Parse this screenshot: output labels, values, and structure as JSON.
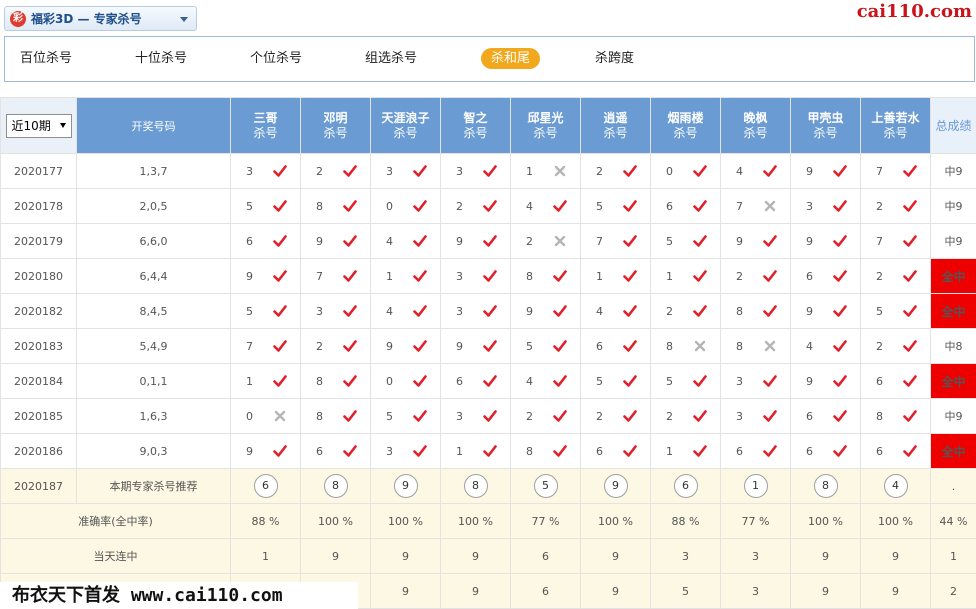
{
  "app": {
    "game_logo": "彩",
    "game_title": "福彩3D — 专家杀号",
    "site_brand": "cai110.com",
    "watermark": "布衣天下首发 www.cai110.com"
  },
  "tabs": [
    {
      "label": "百位杀号"
    },
    {
      "label": "十位杀号"
    },
    {
      "label": "个位杀号"
    },
    {
      "label": "组选杀号"
    },
    {
      "label": "杀和尾"
    },
    {
      "label": "杀跨度"
    }
  ],
  "table": {
    "period_select": "近10期",
    "draw_header": "开奖号码",
    "total_header": "总成绩",
    "expert_subtitle": "杀号",
    "experts": [
      "三哥",
      "邓明",
      "天涯浪子",
      "智之",
      "邱星光",
      "逍遥",
      "烟雨楼",
      "晚枫",
      "甲壳虫",
      "上善若水"
    ],
    "rows": [
      {
        "period": "2020177",
        "draw": "1,3,7",
        "picks": [
          [
            "3",
            "ok"
          ],
          [
            "2",
            "ok"
          ],
          [
            "3",
            "ok"
          ],
          [
            "3",
            "ok"
          ],
          [
            "1",
            "x"
          ],
          [
            "2",
            "ok"
          ],
          [
            "0",
            "ok"
          ],
          [
            "4",
            "ok"
          ],
          [
            "9",
            "ok"
          ],
          [
            "7",
            "ok"
          ]
        ],
        "result": "中9",
        "all": false
      },
      {
        "period": "2020178",
        "draw": "2,0,5",
        "picks": [
          [
            "5",
            "ok"
          ],
          [
            "8",
            "ok"
          ],
          [
            "0",
            "ok"
          ],
          [
            "2",
            "ok"
          ],
          [
            "4",
            "ok"
          ],
          [
            "5",
            "ok"
          ],
          [
            "6",
            "ok"
          ],
          [
            "7",
            "x"
          ],
          [
            "3",
            "ok"
          ],
          [
            "2",
            "ok"
          ]
        ],
        "result": "中9",
        "all": false
      },
      {
        "period": "2020179",
        "draw": "6,6,0",
        "picks": [
          [
            "6",
            "ok"
          ],
          [
            "9",
            "ok"
          ],
          [
            "4",
            "ok"
          ],
          [
            "9",
            "ok"
          ],
          [
            "2",
            "x"
          ],
          [
            "7",
            "ok"
          ],
          [
            "5",
            "ok"
          ],
          [
            "9",
            "ok"
          ],
          [
            "9",
            "ok"
          ],
          [
            "7",
            "ok"
          ]
        ],
        "result": "中9",
        "all": false
      },
      {
        "period": "2020180",
        "draw": "6,4,4",
        "picks": [
          [
            "9",
            "ok"
          ],
          [
            "7",
            "ok"
          ],
          [
            "1",
            "ok"
          ],
          [
            "3",
            "ok"
          ],
          [
            "8",
            "ok"
          ],
          [
            "1",
            "ok"
          ],
          [
            "1",
            "ok"
          ],
          [
            "2",
            "ok"
          ],
          [
            "6",
            "ok"
          ],
          [
            "2",
            "ok"
          ]
        ],
        "result": "全中",
        "all": true
      },
      {
        "period": "2020182",
        "draw": "8,4,5",
        "picks": [
          [
            "5",
            "ok"
          ],
          [
            "3",
            "ok"
          ],
          [
            "4",
            "ok"
          ],
          [
            "3",
            "ok"
          ],
          [
            "9",
            "ok"
          ],
          [
            "4",
            "ok"
          ],
          [
            "2",
            "ok"
          ],
          [
            "8",
            "ok"
          ],
          [
            "9",
            "ok"
          ],
          [
            "5",
            "ok"
          ]
        ],
        "result": "全中",
        "all": true
      },
      {
        "period": "2020183",
        "draw": "5,4,9",
        "picks": [
          [
            "7",
            "ok"
          ],
          [
            "2",
            "ok"
          ],
          [
            "9",
            "ok"
          ],
          [
            "9",
            "ok"
          ],
          [
            "5",
            "ok"
          ],
          [
            "6",
            "ok"
          ],
          [
            "8",
            "x"
          ],
          [
            "8",
            "x"
          ],
          [
            "4",
            "ok"
          ],
          [
            "2",
            "ok"
          ]
        ],
        "result": "中8",
        "all": false
      },
      {
        "period": "2020184",
        "draw": "0,1,1",
        "picks": [
          [
            "1",
            "ok"
          ],
          [
            "8",
            "ok"
          ],
          [
            "0",
            "ok"
          ],
          [
            "6",
            "ok"
          ],
          [
            "4",
            "ok"
          ],
          [
            "5",
            "ok"
          ],
          [
            "5",
            "ok"
          ],
          [
            "3",
            "ok"
          ],
          [
            "9",
            "ok"
          ],
          [
            "6",
            "ok"
          ]
        ],
        "result": "全中",
        "all": true
      },
      {
        "period": "2020185",
        "draw": "1,6,3",
        "picks": [
          [
            "0",
            "x"
          ],
          [
            "8",
            "ok"
          ],
          [
            "5",
            "ok"
          ],
          [
            "3",
            "ok"
          ],
          [
            "2",
            "ok"
          ],
          [
            "2",
            "ok"
          ],
          [
            "2",
            "ok"
          ],
          [
            "3",
            "ok"
          ],
          [
            "6",
            "ok"
          ],
          [
            "8",
            "ok"
          ]
        ],
        "result": "中9",
        "all": false
      },
      {
        "period": "2020186",
        "draw": "9,0,3",
        "picks": [
          [
            "9",
            "ok"
          ],
          [
            "6",
            "ok"
          ],
          [
            "3",
            "ok"
          ],
          [
            "1",
            "ok"
          ],
          [
            "8",
            "ok"
          ],
          [
            "6",
            "ok"
          ],
          [
            "1",
            "ok"
          ],
          [
            "6",
            "ok"
          ],
          [
            "6",
            "ok"
          ],
          [
            "6",
            "ok"
          ]
        ],
        "result": "全中",
        "all": true
      }
    ],
    "recommend": {
      "period": "2020187",
      "label": "本期专家杀号推荐",
      "numbers": [
        "6",
        "8",
        "9",
        "8",
        "5",
        "9",
        "6",
        "1",
        "8",
        "4"
      ],
      "end": "."
    },
    "accuracy": {
      "label": "准确率(全中率)",
      "values": [
        "88 %",
        "100 %",
        "100 %",
        "100 %",
        "77 %",
        "100 %",
        "88 %",
        "77 %",
        "100 %",
        "100 %"
      ],
      "total": "44 %"
    },
    "streak_today": {
      "label": "当天连中",
      "values": [
        "1",
        "9",
        "9",
        "9",
        "6",
        "9",
        "3",
        "3",
        "9",
        "9"
      ],
      "total": "1"
    },
    "streak_max": {
      "label": "",
      "values": [
        "",
        "",
        "9",
        "9",
        "6",
        "9",
        "5",
        "3",
        "9",
        "9"
      ],
      "total": "2"
    }
  },
  "colors": {
    "header_blue": "#6a9bd2",
    "active_tab": "#f1a81c",
    "check_red": "#e0202a",
    "cross_gray": "#b5b5b5",
    "all_hit_red": "#ee0000",
    "footer_cream": "#fdf8e3"
  }
}
